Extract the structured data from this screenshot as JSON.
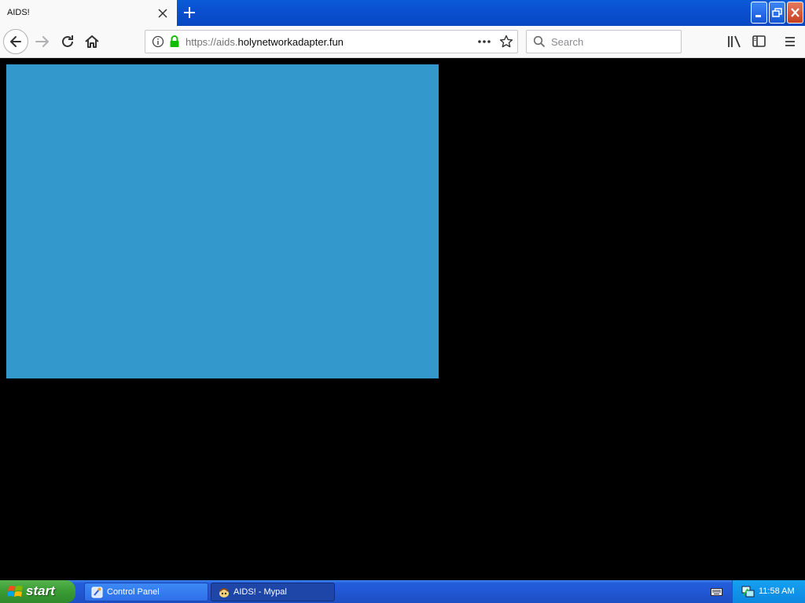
{
  "browser": {
    "tab": {
      "title": "AIDS!"
    },
    "url": {
      "scheme_prefix": "https://aids.",
      "domain": "holynetworkadapter.fun"
    },
    "search": {
      "placeholder": "Search"
    }
  },
  "taskbar": {
    "start_label": "start",
    "buttons": [
      {
        "label": "Control Panel",
        "active": false,
        "icon": "control-panel-icon"
      },
      {
        "label": "AIDS! - Mypal",
        "active": true,
        "icon": "mypal-icon"
      }
    ],
    "clock": "11:58 AM"
  },
  "page": {
    "content_color": "#3399cc",
    "background_color": "#000000"
  }
}
